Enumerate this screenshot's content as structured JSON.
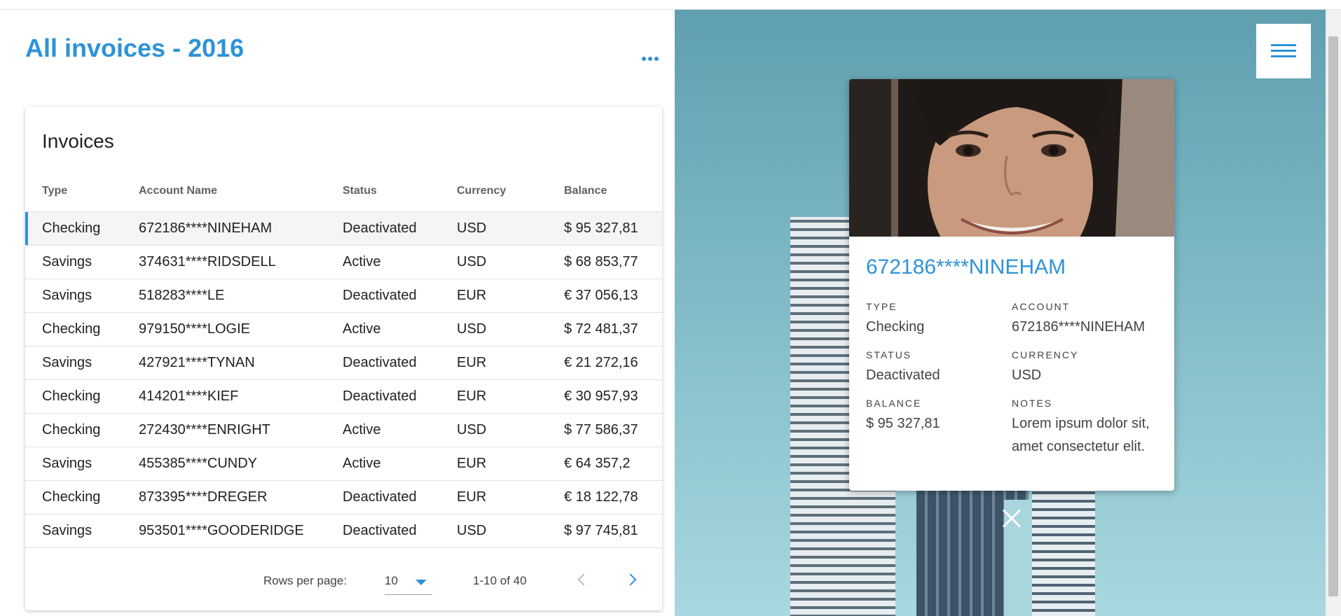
{
  "page": {
    "title": "All invoices - 2016"
  },
  "table_card": {
    "title": "Invoices",
    "columns": [
      "Type",
      "Account Name",
      "Status",
      "Currency",
      "Balance"
    ],
    "rows": [
      {
        "type": "Checking",
        "account": "672186****NINEHAM",
        "status": "Deactivated",
        "currency": "USD",
        "balance": "$ 95 327,81"
      },
      {
        "type": "Savings",
        "account": "374631****RIDSDELL",
        "status": "Active",
        "currency": "USD",
        "balance": "$ 68 853,77"
      },
      {
        "type": "Savings",
        "account": "518283****LE",
        "status": "Deactivated",
        "currency": "EUR",
        "balance": "€ 37 056,13"
      },
      {
        "type": "Checking",
        "account": "979150****LOGIE",
        "status": "Active",
        "currency": "USD",
        "balance": "$ 72 481,37"
      },
      {
        "type": "Savings",
        "account": "427921****TYNAN",
        "status": "Deactivated",
        "currency": "EUR",
        "balance": "€ 21 272,16"
      },
      {
        "type": "Checking",
        "account": "414201****KIEF",
        "status": "Deactivated",
        "currency": "EUR",
        "balance": "€ 30 957,93"
      },
      {
        "type": "Checking",
        "account": "272430****ENRIGHT",
        "status": "Active",
        "currency": "USD",
        "balance": "$ 77 586,37"
      },
      {
        "type": "Savings",
        "account": "455385****CUNDY",
        "status": "Active",
        "currency": "EUR",
        "balance": "€ 64 357,2"
      },
      {
        "type": "Checking",
        "account": "873395****DREGER",
        "status": "Deactivated",
        "currency": "EUR",
        "balance": "€ 18 122,78"
      },
      {
        "type": "Savings",
        "account": "953501****GOODERIDGE",
        "status": "Deactivated",
        "currency": "USD",
        "balance": "$ 97 745,81"
      }
    ],
    "pagination": {
      "rows_per_page_label": "Rows per page:",
      "rows_per_page": "10",
      "range": "1-10 of 40"
    }
  },
  "detail_card": {
    "name": "672186****NINEHAM",
    "fields": {
      "type": {
        "label": "Type",
        "value": "Checking"
      },
      "account": {
        "label": "Account",
        "value": "672186****NINEHAM"
      },
      "status": {
        "label": "Status",
        "value": "Deactivated"
      },
      "currency": {
        "label": "Currency",
        "value": "USD"
      },
      "balance": {
        "label": "Balance",
        "value": "$ 95 327,81"
      },
      "notes": {
        "label": "Notes",
        "value": "Lorem ipsum dolor sit, amet consectetur elit."
      }
    }
  },
  "icons": {
    "more": "more-horiz-icon",
    "menu": "hamburger-menu-icon",
    "close": "close-icon",
    "caret": "caret-down-icon",
    "prev": "chevron-left-icon",
    "next": "chevron-right-icon"
  },
  "colors": {
    "accent": "#2e93d8",
    "background_panel": "#7fb9c5",
    "selected_row": "#f5f5f5"
  }
}
